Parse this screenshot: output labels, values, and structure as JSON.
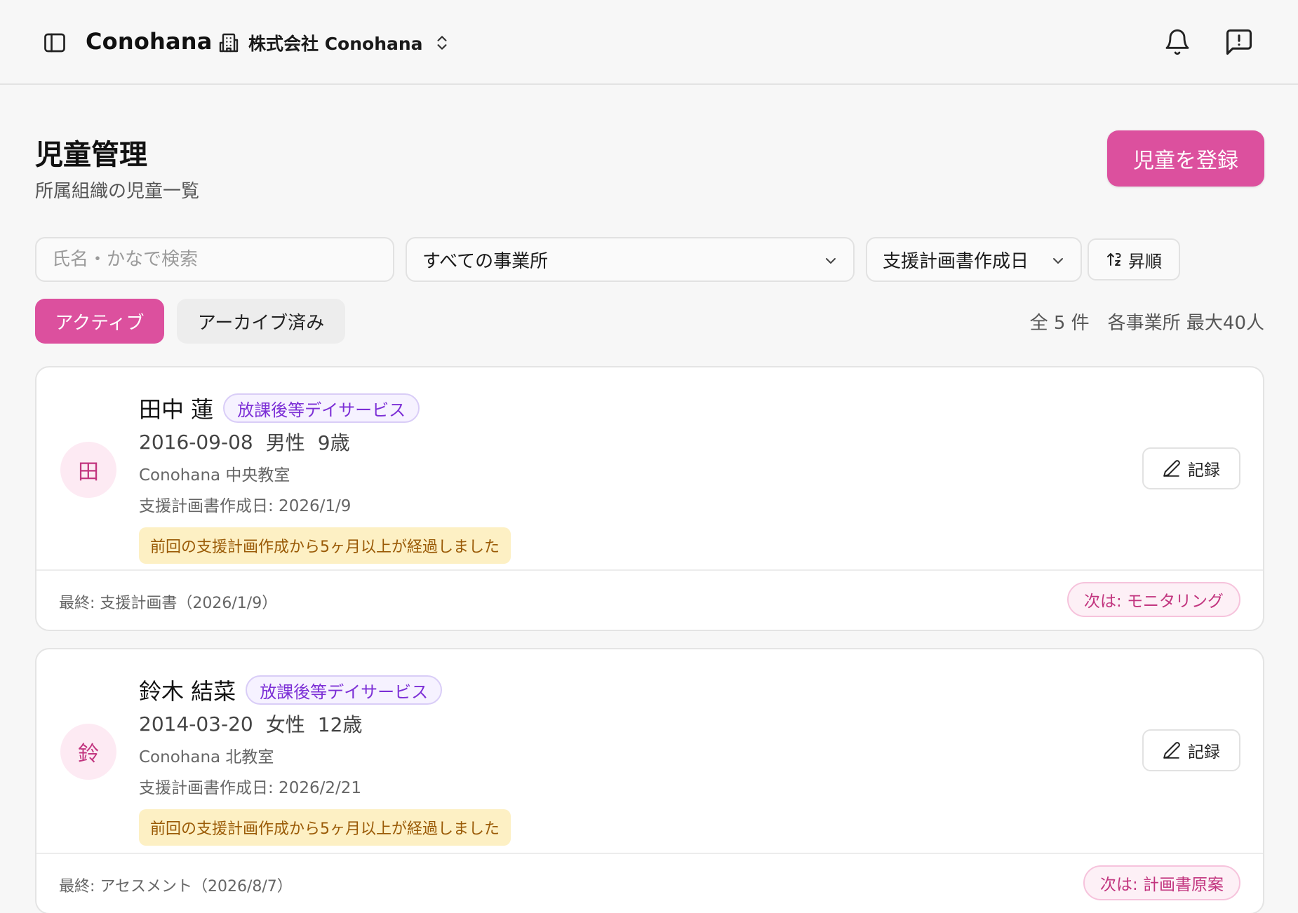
{
  "header": {
    "brand": "Conohana",
    "organization": "株式会社 Conohana"
  },
  "page": {
    "title": "児童管理",
    "subtitle": "所属組織の児童一覧",
    "register_label": "児童を登録"
  },
  "filters": {
    "search_placeholder": "氏名・かなで検索",
    "facility_selected": "すべての事業所",
    "sort_selected": "支援計画書作成日",
    "order_label": "昇順"
  },
  "tabs": {
    "active": "アクティブ",
    "archived": "アーカイブ済み"
  },
  "summary": {
    "total": "全 5 件",
    "capacity": "各事業所 最大40人"
  },
  "children": [
    {
      "initial": "田",
      "name": "田中 蓮",
      "service": "放課後等デイサービス",
      "birthdate": "2016-09-08",
      "gender": "男性",
      "age": "9歳",
      "facility": "Conohana 中央教室",
      "plan_date": "支援計画書作成日: 2026/1/9",
      "warning": "前回の支援計画作成から5ヶ月以上が経過しました",
      "record_label": "記録",
      "last": "最終: 支援計画書（2026/1/9）",
      "next": "次は: モニタリング"
    },
    {
      "initial": "鈴",
      "name": "鈴木 結菜",
      "service": "放課後等デイサービス",
      "birthdate": "2014-03-20",
      "gender": "女性",
      "age": "12歳",
      "facility": "Conohana 北教室",
      "plan_date": "支援計画書作成日: 2026/2/21",
      "warning": "前回の支援計画作成から5ヶ月以上が経過しました",
      "record_label": "記録",
      "last": "最終: アセスメント（2026/8/7）",
      "next": "次は: 計画書原案"
    }
  ],
  "colors": {
    "accent": "#dc509e",
    "service_badge": "#7c2fd6",
    "warning_bg": "#fdf0c4",
    "warning_text": "#9a5a06"
  }
}
